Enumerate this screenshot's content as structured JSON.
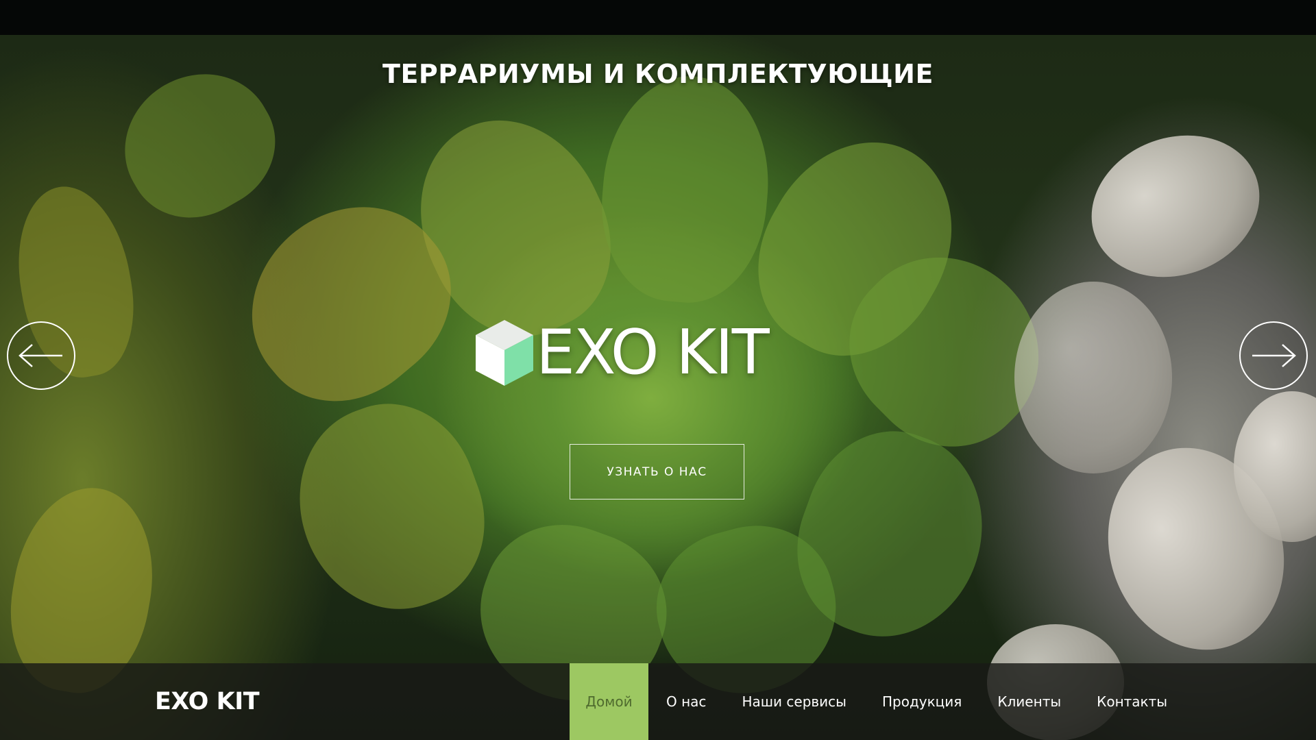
{
  "hero": {
    "headline": "ТЕРРАРИУМЫ И КОМПЛЕКТУЮЩИЕ",
    "logo_text": "EXO KIT",
    "cta_label": "УЗНАТЬ О НАС",
    "prev_icon": "arrow-left-icon",
    "next_icon": "arrow-right-icon"
  },
  "navbar": {
    "brand": "EXO KIT",
    "items": [
      {
        "label": "Домой",
        "active": true
      },
      {
        "label": "О нас",
        "active": false
      },
      {
        "label": "Наши сервисы",
        "active": false
      },
      {
        "label": "Продукция",
        "active": false
      },
      {
        "label": "Клиенты",
        "active": false
      },
      {
        "label": "Контакты",
        "active": false
      }
    ]
  },
  "colors": {
    "accent": "#9dc862",
    "active_text": "#4f6b2e",
    "navbar_bg": "#181a16",
    "text": "#ffffff"
  }
}
